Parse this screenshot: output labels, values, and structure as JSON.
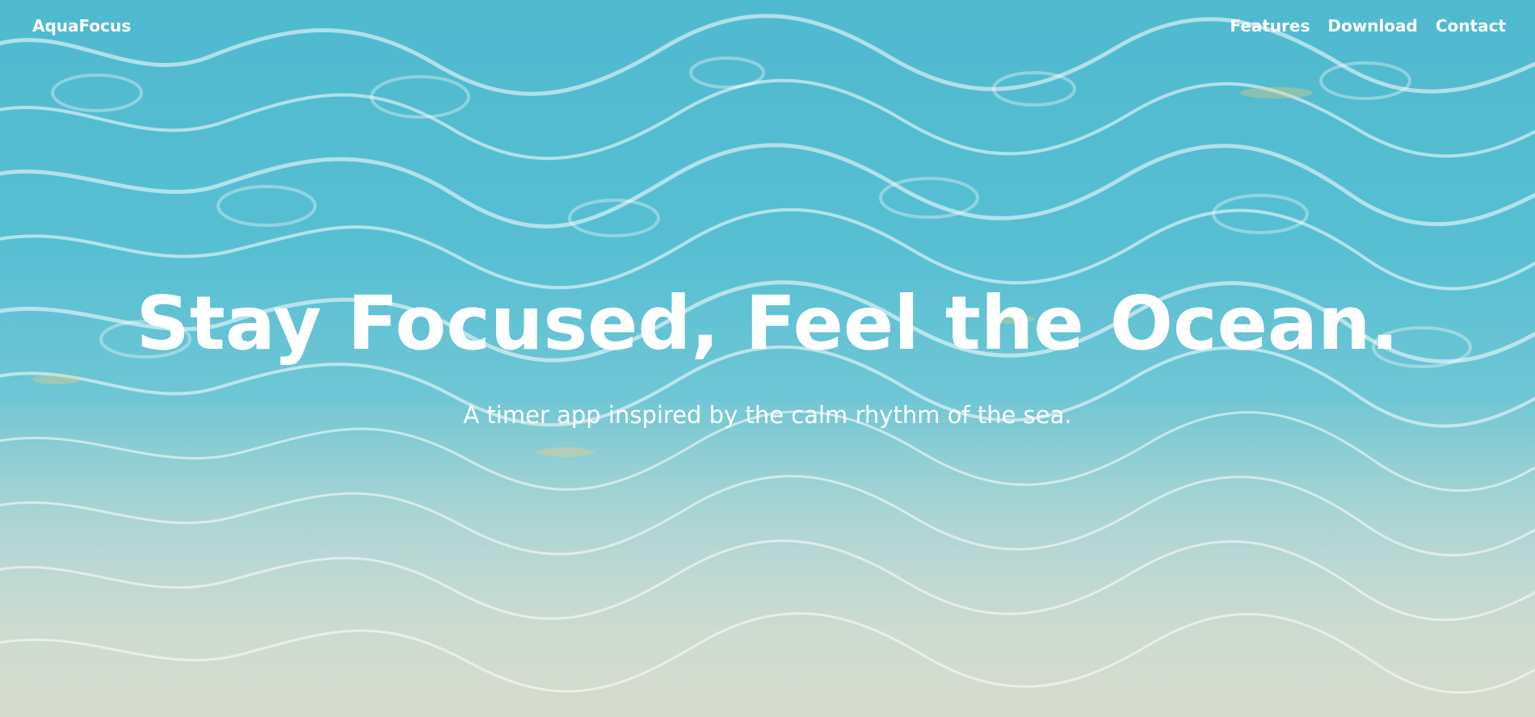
{
  "brand": {
    "name": "AquaFocus"
  },
  "nav": {
    "links": [
      {
        "label": "Features"
      },
      {
        "label": "Download"
      },
      {
        "label": "Contact"
      }
    ]
  },
  "hero": {
    "title": "Stay Focused, Feel the Ocean.",
    "subtitle": "A timer app inspired by the calm rhythm of the sea."
  },
  "colors": {
    "water_top": "#4fb9cf",
    "water_mid": "#6ec6d4",
    "sand": "#cdd8cc",
    "text": "#ffffff"
  },
  "background": {
    "icon": "water-ripple-background"
  }
}
